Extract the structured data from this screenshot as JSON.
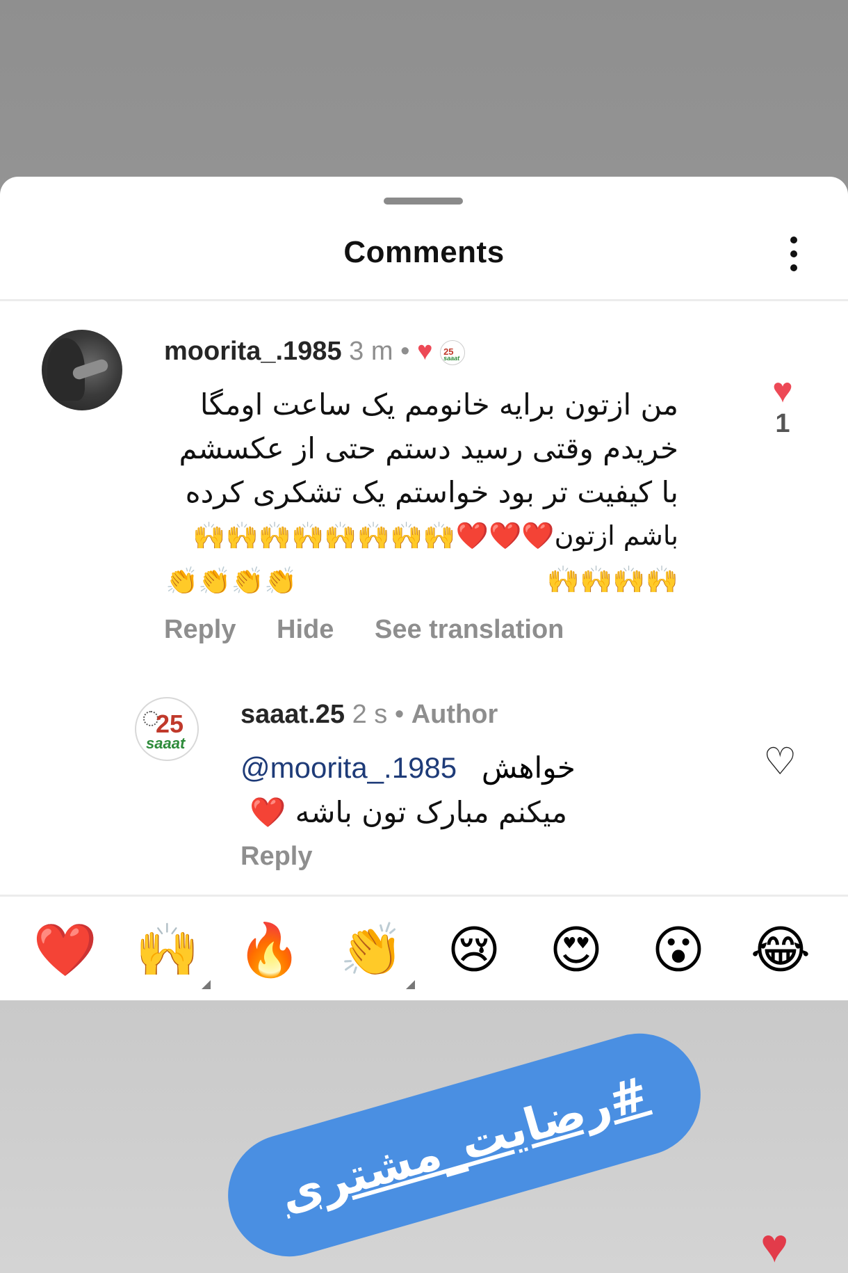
{
  "sheet": {
    "title": "Comments"
  },
  "comments": [
    {
      "username": "moorita_.1985",
      "time": "3 m",
      "separator": "•",
      "liked_by_author": "♥",
      "text_lines": [
        "من ازتون برایه خانومم یک ساعت اومگا",
        "خریدم وقتی رسید دستم حتی از عکسشم",
        "با کیفیت تر بود خواستم یک تشکری کرده",
        "باشم ازتون❤️❤️❤️🙌🙌🙌🙌🙌🙌🙌🙌🙌🙌🙌🙌"
      ],
      "emoji_line": "👏👏👏👏",
      "actions": [
        "Reply",
        "Hide",
        "See translation"
      ],
      "like_icon": "heart-filled-icon",
      "like_count": "1"
    },
    {
      "username": "saaat.25",
      "time": "2 s",
      "separator": "•",
      "badge": "Author",
      "mention": "@moorita_.1985",
      "text_first": "خواهش",
      "text_second": "میکنم مبارک تون باشه ❤️",
      "actions": [
        "Reply"
      ],
      "like_icon": "heart-outline-icon"
    }
  ],
  "avatars": {
    "logo_number": "25",
    "logo_word": "saaat"
  },
  "reactions": [
    "❤️",
    "🙌",
    "🔥",
    "👏",
    "😢",
    "😍",
    "😮",
    "😂"
  ],
  "hashtag": "#رضایت_مشتری",
  "colors": {
    "like_red": "#ed4956",
    "mention_blue": "#1e3b78",
    "hashtag_bg": "#4a8fe2",
    "muted_gray": "#8e8e8e"
  }
}
